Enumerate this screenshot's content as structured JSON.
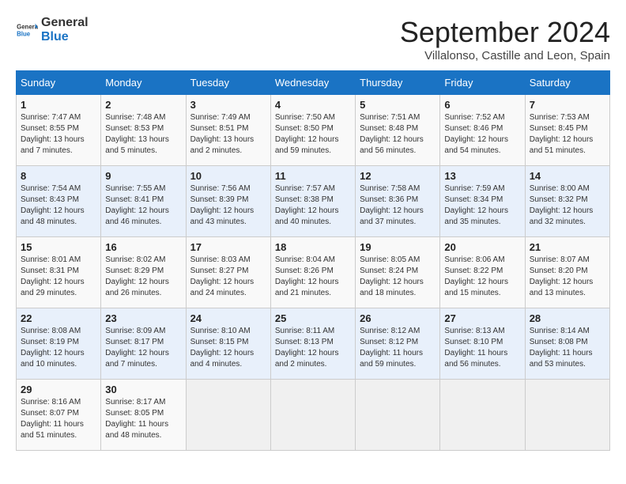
{
  "header": {
    "logo_line1": "General",
    "logo_line2": "Blue",
    "month_title": "September 2024",
    "location": "Villalonso, Castille and Leon, Spain"
  },
  "calendar": {
    "days_of_week": [
      "Sunday",
      "Monday",
      "Tuesday",
      "Wednesday",
      "Thursday",
      "Friday",
      "Saturday"
    ],
    "weeks": [
      [
        {
          "day": "",
          "info": ""
        },
        {
          "day": "2",
          "info": "Sunrise: 7:48 AM\nSunset: 8:53 PM\nDaylight: 13 hours and 5 minutes."
        },
        {
          "day": "3",
          "info": "Sunrise: 7:49 AM\nSunset: 8:51 PM\nDaylight: 13 hours and 2 minutes."
        },
        {
          "day": "4",
          "info": "Sunrise: 7:50 AM\nSunset: 8:50 PM\nDaylight: 12 hours and 59 minutes."
        },
        {
          "day": "5",
          "info": "Sunrise: 7:51 AM\nSunset: 8:48 PM\nDaylight: 12 hours and 56 minutes."
        },
        {
          "day": "6",
          "info": "Sunrise: 7:52 AM\nSunset: 8:46 PM\nDaylight: 12 hours and 54 minutes."
        },
        {
          "day": "7",
          "info": "Sunrise: 7:53 AM\nSunset: 8:45 PM\nDaylight: 12 hours and 51 minutes."
        }
      ],
      [
        {
          "day": "8",
          "info": "Sunrise: 7:54 AM\nSunset: 8:43 PM\nDaylight: 12 hours and 48 minutes."
        },
        {
          "day": "9",
          "info": "Sunrise: 7:55 AM\nSunset: 8:41 PM\nDaylight: 12 hours and 46 minutes."
        },
        {
          "day": "10",
          "info": "Sunrise: 7:56 AM\nSunset: 8:39 PM\nDaylight: 12 hours and 43 minutes."
        },
        {
          "day": "11",
          "info": "Sunrise: 7:57 AM\nSunset: 8:38 PM\nDaylight: 12 hours and 40 minutes."
        },
        {
          "day": "12",
          "info": "Sunrise: 7:58 AM\nSunset: 8:36 PM\nDaylight: 12 hours and 37 minutes."
        },
        {
          "day": "13",
          "info": "Sunrise: 7:59 AM\nSunset: 8:34 PM\nDaylight: 12 hours and 35 minutes."
        },
        {
          "day": "14",
          "info": "Sunrise: 8:00 AM\nSunset: 8:32 PM\nDaylight: 12 hours and 32 minutes."
        }
      ],
      [
        {
          "day": "15",
          "info": "Sunrise: 8:01 AM\nSunset: 8:31 PM\nDaylight: 12 hours and 29 minutes."
        },
        {
          "day": "16",
          "info": "Sunrise: 8:02 AM\nSunset: 8:29 PM\nDaylight: 12 hours and 26 minutes."
        },
        {
          "day": "17",
          "info": "Sunrise: 8:03 AM\nSunset: 8:27 PM\nDaylight: 12 hours and 24 minutes."
        },
        {
          "day": "18",
          "info": "Sunrise: 8:04 AM\nSunset: 8:26 PM\nDaylight: 12 hours and 21 minutes."
        },
        {
          "day": "19",
          "info": "Sunrise: 8:05 AM\nSunset: 8:24 PM\nDaylight: 12 hours and 18 minutes."
        },
        {
          "day": "20",
          "info": "Sunrise: 8:06 AM\nSunset: 8:22 PM\nDaylight: 12 hours and 15 minutes."
        },
        {
          "day": "21",
          "info": "Sunrise: 8:07 AM\nSunset: 8:20 PM\nDaylight: 12 hours and 13 minutes."
        }
      ],
      [
        {
          "day": "22",
          "info": "Sunrise: 8:08 AM\nSunset: 8:19 PM\nDaylight: 12 hours and 10 minutes."
        },
        {
          "day": "23",
          "info": "Sunrise: 8:09 AM\nSunset: 8:17 PM\nDaylight: 12 hours and 7 minutes."
        },
        {
          "day": "24",
          "info": "Sunrise: 8:10 AM\nSunset: 8:15 PM\nDaylight: 12 hours and 4 minutes."
        },
        {
          "day": "25",
          "info": "Sunrise: 8:11 AM\nSunset: 8:13 PM\nDaylight: 12 hours and 2 minutes."
        },
        {
          "day": "26",
          "info": "Sunrise: 8:12 AM\nSunset: 8:12 PM\nDaylight: 11 hours and 59 minutes."
        },
        {
          "day": "27",
          "info": "Sunrise: 8:13 AM\nSunset: 8:10 PM\nDaylight: 11 hours and 56 minutes."
        },
        {
          "day": "28",
          "info": "Sunrise: 8:14 AM\nSunset: 8:08 PM\nDaylight: 11 hours and 53 minutes."
        }
      ],
      [
        {
          "day": "29",
          "info": "Sunrise: 8:16 AM\nSunset: 8:07 PM\nDaylight: 11 hours and 51 minutes."
        },
        {
          "day": "30",
          "info": "Sunrise: 8:17 AM\nSunset: 8:05 PM\nDaylight: 11 hours and 48 minutes."
        },
        {
          "day": "",
          "info": ""
        },
        {
          "day": "",
          "info": ""
        },
        {
          "day": "",
          "info": ""
        },
        {
          "day": "",
          "info": ""
        },
        {
          "day": "",
          "info": ""
        }
      ]
    ],
    "week0_day1": {
      "day": "1",
      "info": "Sunrise: 7:47 AM\nSunset: 8:55 PM\nDaylight: 13 hours and 7 minutes."
    }
  }
}
